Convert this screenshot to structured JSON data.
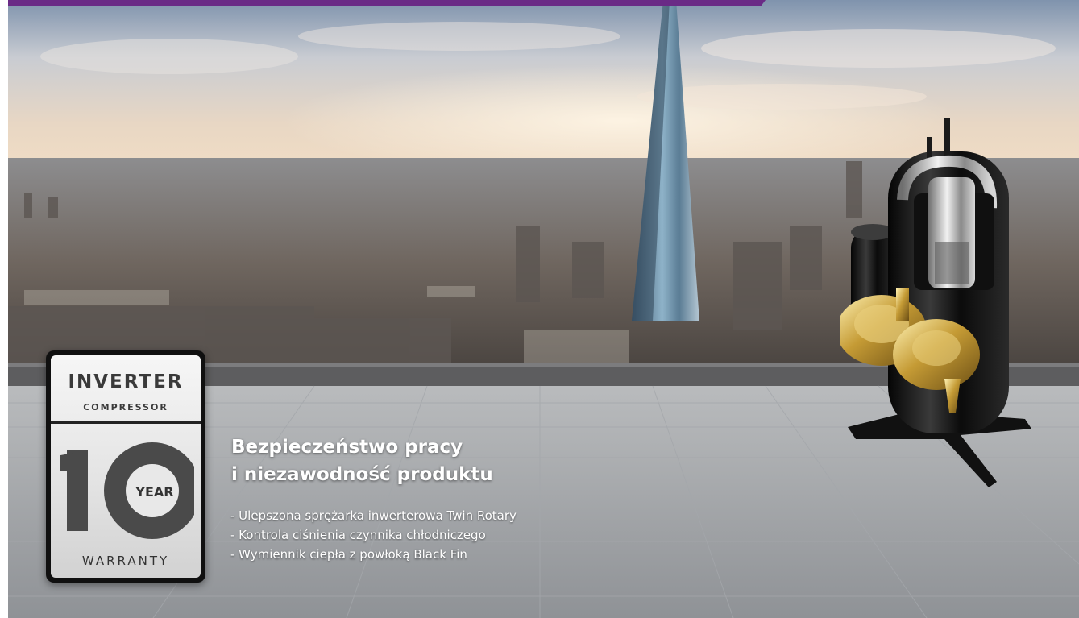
{
  "colors": {
    "accent_strip": "#6a2a86",
    "text": "#ffffff",
    "badge_text": "#3a3a3a"
  },
  "badge": {
    "line1": "INVERTER",
    "line2": "COMPRESSOR",
    "number": "10",
    "year_label": "YEAR",
    "warranty_label": "WARRANTY"
  },
  "headline": {
    "line1": "Bezpieczeństwo pracy",
    "line2": "i niezawodność produktu"
  },
  "features": [
    "- Ulepszona sprężarka inwerterowa Twin Rotary",
    "- Kontrola ciśnienia czynnika chłodniczego",
    "- Wymiennik ciepła z powłoką Black Fin"
  ]
}
